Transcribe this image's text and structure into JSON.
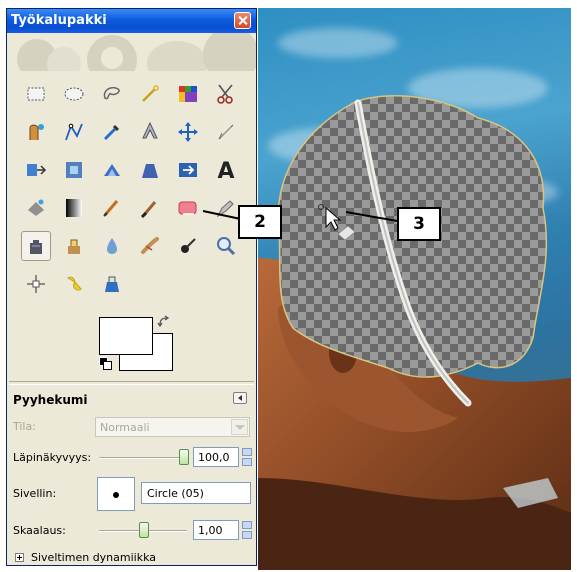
{
  "window": {
    "title": "Työkalupakki"
  },
  "tools": [
    "rect-select",
    "ellipse-select",
    "free-select",
    "fuzzy-select",
    "select-by-color",
    "scissors",
    "foreground-select",
    "paths",
    "color-picker",
    "zoom",
    "measure",
    "move",
    "align",
    "crop",
    "rotate",
    "scale",
    "shear",
    "perspective",
    "flip",
    "text",
    "bucket-fill",
    "blend",
    "pencil",
    "paintbrush",
    "eraser",
    "airbrush",
    "ink",
    "clone",
    "heal",
    "perspective-clone",
    "blur",
    "smudge",
    "dodge-burn"
  ],
  "active_tool": "eraser",
  "options": {
    "title": "Pyyhekumi",
    "mode_label": "Tila:",
    "mode_value": "Normaali",
    "opacity_label": "Läpinäkyvyys:",
    "opacity_value": "100,0",
    "opacity_level": 1.0,
    "brush_label": "Sivellin:",
    "brush_value": "Circle (05)",
    "scale_label": "Skaalaus:",
    "scale_value": "1,00",
    "scale_level": 0.5,
    "dynamics_label": "Siveltimen dynamiikka"
  },
  "callouts": {
    "tool_marker": "2",
    "cursor_marker": "3"
  },
  "colors": {
    "titlebar": "#0a4fd0",
    "panel": "#ece9d8",
    "water": "#2f7fb1"
  }
}
